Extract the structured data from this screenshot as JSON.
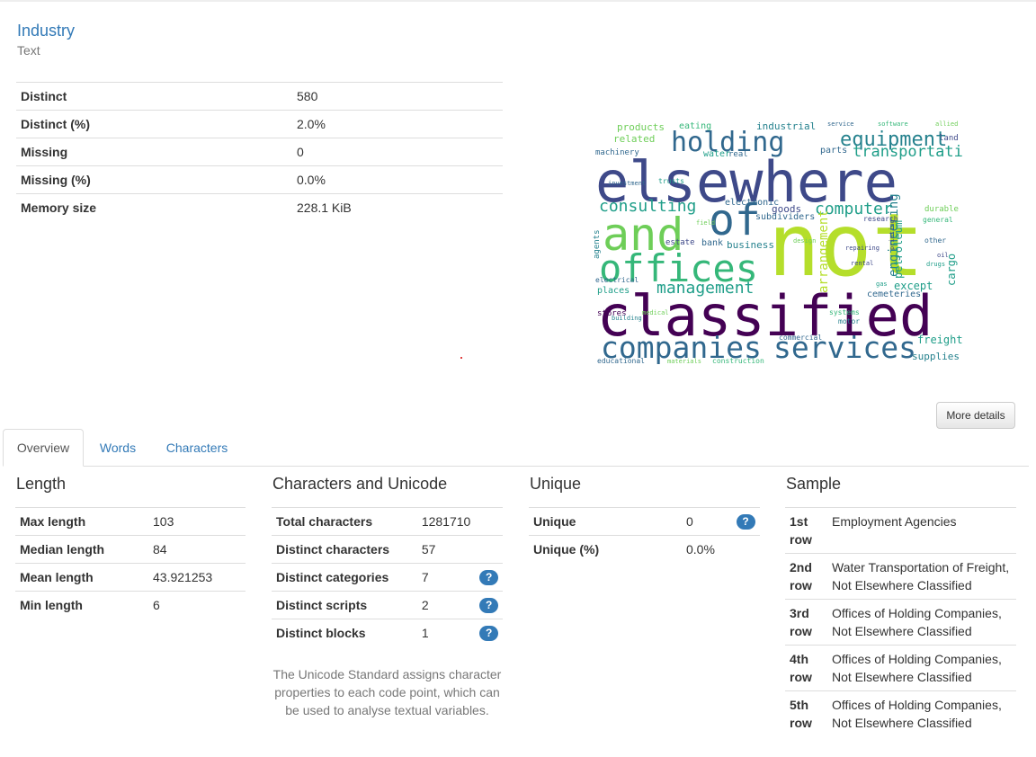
{
  "variable": {
    "name": "Industry",
    "type": "Text"
  },
  "summary": [
    {
      "label": "Distinct",
      "value": "580"
    },
    {
      "label": "Distinct (%)",
      "value": "2.0%"
    },
    {
      "label": "Missing",
      "value": "0"
    },
    {
      "label": "Missing (%)",
      "value": "0.0%"
    },
    {
      "label": "Memory size",
      "value": "228.1 KiB"
    }
  ],
  "wordcloud": {
    "words": [
      "not",
      "classified",
      "elsewhere",
      "and",
      "of",
      "offices",
      "companies",
      "services",
      "holding",
      "equipment",
      "consulting",
      "management",
      "computer",
      "transportation",
      "products",
      "related",
      "machinery",
      "industrial",
      "eating",
      "service",
      "software",
      "allied",
      "land",
      "parts",
      "water",
      "real",
      "estate",
      "goods",
      "subdividers",
      "electronic",
      "business",
      "arrangement",
      "engineering",
      "petroleum",
      "cargo",
      "except",
      "freight",
      "supplies",
      "cemeteries",
      "places",
      "stores",
      "agents",
      "electrical",
      "construction",
      "materials",
      "educational",
      "commercial",
      "motor",
      "systems",
      "research",
      "general",
      "durable",
      "other",
      "bank",
      "design",
      "investment",
      "trusts",
      "gas",
      "drugs",
      "printing",
      "oil",
      "repairing",
      "rental",
      "field",
      "building",
      "medical"
    ],
    "colors": [
      "#440154",
      "#482878",
      "#3e4989",
      "#31688e",
      "#26828e",
      "#1f9e89",
      "#35b779",
      "#6ece58",
      "#b5de2b",
      "#fde725"
    ]
  },
  "more_details_label": "More details",
  "tabs": [
    "Overview",
    "Words",
    "Characters"
  ],
  "length": {
    "title": "Length",
    "rows": [
      {
        "label": "Max length",
        "value": "103"
      },
      {
        "label": "Median length",
        "value": "84"
      },
      {
        "label": "Mean length",
        "value": "43.921253"
      },
      {
        "label": "Min length",
        "value": "6"
      }
    ]
  },
  "characters": {
    "title": "Characters and Unicode",
    "rows": [
      {
        "label": "Total characters",
        "value": "1281710"
      },
      {
        "label": "Distinct characters",
        "value": "57"
      },
      {
        "label": "Distinct categories",
        "value": "7",
        "help": "?"
      },
      {
        "label": "Distinct scripts",
        "value": "2",
        "help": "?"
      },
      {
        "label": "Distinct blocks",
        "value": "1",
        "help": "?"
      }
    ],
    "note": "The Unicode Standard assigns character properties to each code point, which can be used to analyse textual variables."
  },
  "unique": {
    "title": "Unique",
    "rows": [
      {
        "label": "Unique",
        "value": "0",
        "help": "?"
      },
      {
        "label": "Unique (%)",
        "value": "0.0%"
      }
    ]
  },
  "sample": {
    "title": "Sample",
    "rows": [
      {
        "label": "1st row",
        "value": "Employment Agencies"
      },
      {
        "label": "2nd row",
        "value": "Water Transportation of Freight, Not Elsewhere Classified"
      },
      {
        "label": "3rd row",
        "value": "Offices of Holding Companies, Not Elsewhere Classified"
      },
      {
        "label": "4th row",
        "value": "Offices of Holding Companies, Not Elsewhere Classified"
      },
      {
        "label": "5th row",
        "value": "Offices of Holding Companies, Not Elsewhere Classified"
      }
    ]
  }
}
